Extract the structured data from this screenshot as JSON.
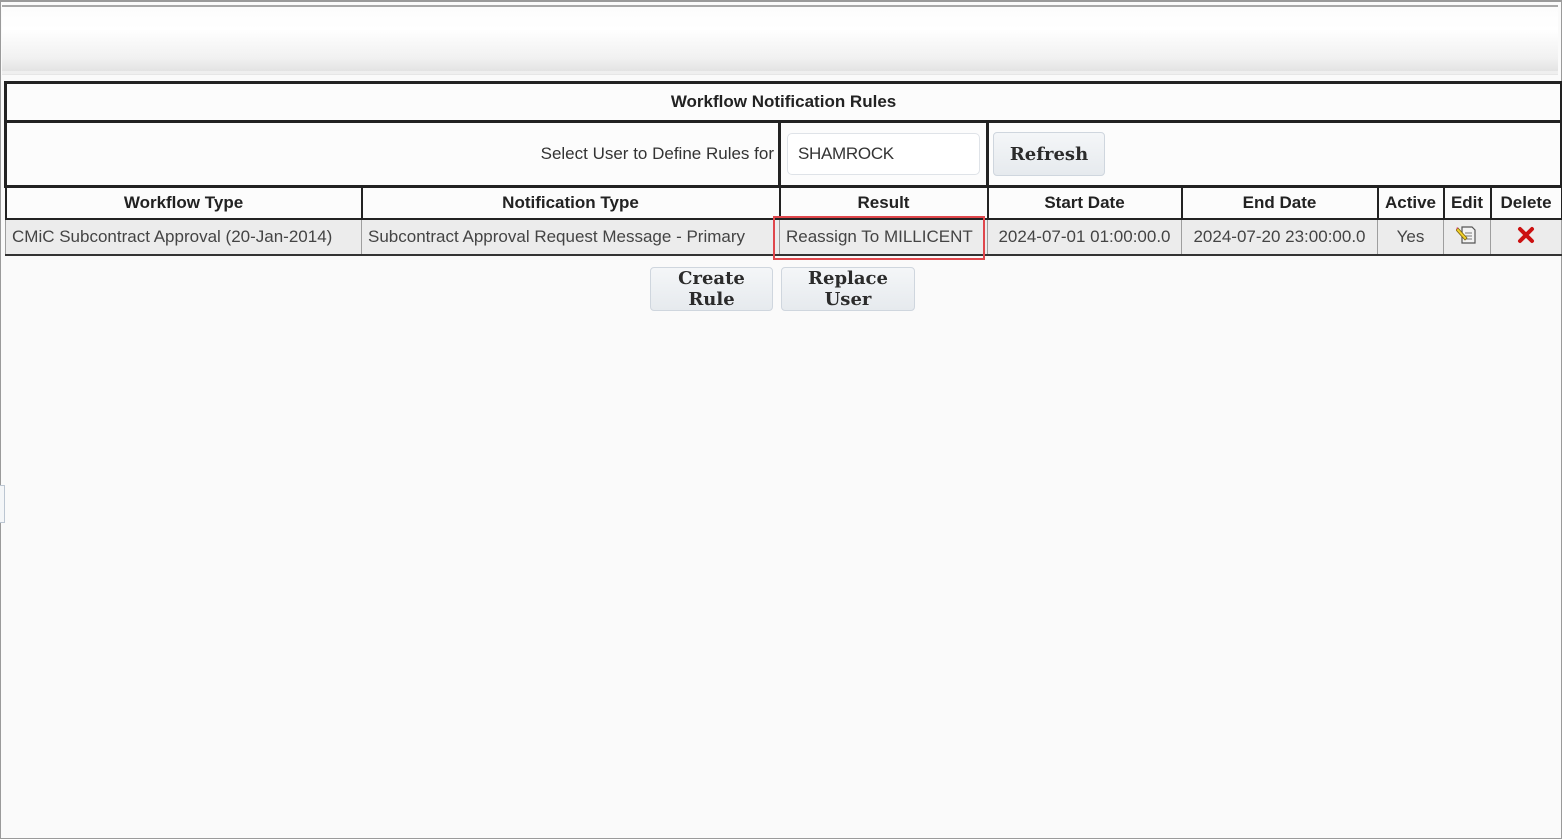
{
  "panel": {
    "title": "Workflow Notification Rules"
  },
  "user_selector": {
    "label": "Select User to Define Rules for",
    "value": "SHAMROCK",
    "search_icon": "search-icon",
    "refresh_label": "Refresh"
  },
  "table": {
    "columns": [
      "Workflow Type",
      "Notification Type",
      "Result",
      "Start Date",
      "End Date",
      "Active",
      "Edit",
      "Delete"
    ],
    "rows": [
      {
        "workflow_type": "CMiC Subcontract Approval (20-Jan-2014)",
        "notification_type": "Subcontract Approval Request Message - Primary",
        "result": "Reassign To MILLICENT",
        "start_date": "2024-07-01 01:00:00.0",
        "end_date": "2024-07-20 23:00:00.0",
        "active": "Yes",
        "edit_icon": "edit-icon",
        "delete_icon": "delete-icon"
      }
    ]
  },
  "highlight": {
    "target": "Result",
    "color": "#e0474c"
  },
  "actions": {
    "create_rule_label": "Create Rule",
    "replace_user_label": "Replace User"
  }
}
